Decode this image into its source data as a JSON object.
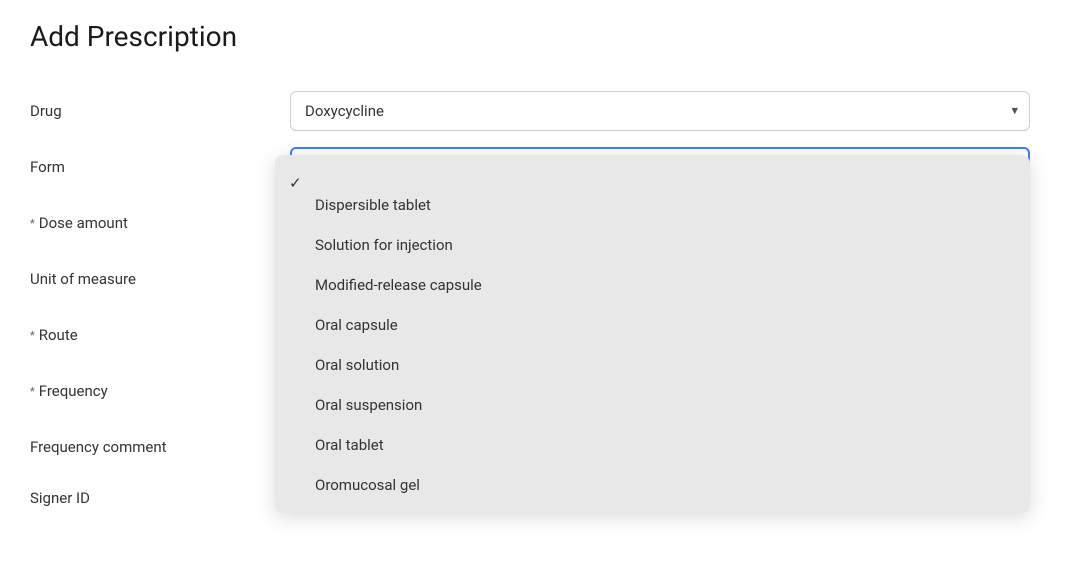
{
  "page": {
    "title": "Add Prescription"
  },
  "form": {
    "drug_label": "Drug",
    "drug_value": "Doxycycline",
    "form_label": "Form",
    "form_value": "",
    "dose_label": "Dose amount",
    "dose_required": "* ",
    "unit_label": "Unit of measure",
    "route_label": "Route",
    "route_required": "* ",
    "frequency_label": "Frequency",
    "frequency_required": "* ",
    "freq_comment_label": "Frequency comment",
    "signer_label": "Signer ID"
  },
  "dropdown": {
    "items": [
      {
        "label": "",
        "checked": true
      },
      {
        "label": "Dispersible tablet",
        "checked": false
      },
      {
        "label": "Solution for injection",
        "checked": false
      },
      {
        "label": "Modified-release capsule",
        "checked": false
      },
      {
        "label": "Oral capsule",
        "checked": false
      },
      {
        "label": "Oral solution",
        "checked": false
      },
      {
        "label": "Oral suspension",
        "checked": false
      },
      {
        "label": "Oral tablet",
        "checked": false
      },
      {
        "label": "Oromucosal gel",
        "checked": false
      }
    ]
  },
  "icons": {
    "chevron_down": "▾",
    "checkmark": "✓"
  }
}
